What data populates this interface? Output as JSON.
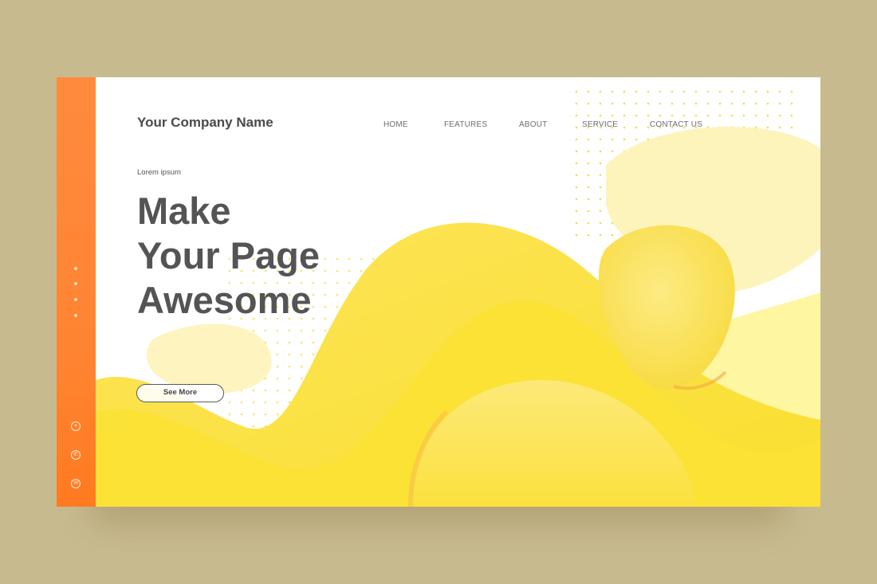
{
  "brand": {
    "name": "Your Company Name"
  },
  "nav": {
    "items": [
      "HOME",
      "FEATURES",
      "ABOUT",
      "SERVICE",
      "CONTACT US"
    ]
  },
  "hero": {
    "eyebrow": "Lorem ipsum",
    "headline": [
      "Make",
      "Your Page",
      "Awesome"
    ],
    "cta_label": "See More"
  },
  "sidebar": {
    "dots": 4,
    "icons": [
      "location-pin-icon",
      "phone-icon",
      "mail-icon"
    ]
  },
  "colors": {
    "background": "#c8ba8f",
    "sidebar_orange": "#ff8431",
    "blob_yellow": "#fbe03a",
    "pale_yellow": "#fdf2a6",
    "text_dark": "#545454"
  }
}
